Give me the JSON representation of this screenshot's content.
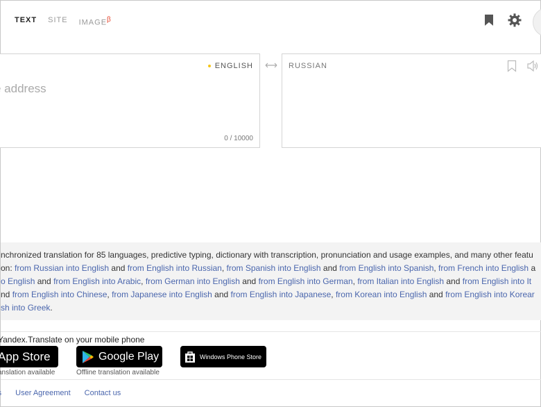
{
  "tabs": [
    {
      "label": "TEXT",
      "sup": ""
    },
    {
      "label": "SITE",
      "sup": ""
    },
    {
      "label": "IMAGE",
      "sup": "β"
    }
  ],
  "header_icons": [
    "bookmark-icon",
    "gear-icon"
  ],
  "source": {
    "language": "ENGLISH",
    "placeholder": "e address",
    "counter": "0 / 10000"
  },
  "target": {
    "language": "RUSSIAN"
  },
  "info": {
    "line1": "nchronized translation for 85 languages, predictive typing, dictionary with transcription, pronunciation and usage examples, and many other featu",
    "line2": [
      {
        "t": "on: "
      },
      {
        "t": "from Russian into English",
        "link": true
      },
      {
        "t": " and "
      },
      {
        "t": "from English into Russian",
        "link": true
      },
      {
        "t": ", "
      },
      {
        "t": "from Spanish into English",
        "link": true
      },
      {
        "t": " and "
      },
      {
        "t": "from English into Spanish",
        "link": true
      },
      {
        "t": ", "
      },
      {
        "t": "from French into English",
        "link": true
      },
      {
        "t": " a"
      }
    ],
    "line3": [
      {
        "t": "o English",
        "link": true
      },
      {
        "t": " and "
      },
      {
        "t": "from English into Arabic",
        "link": true
      },
      {
        "t": ", "
      },
      {
        "t": "from German into English",
        "link": true
      },
      {
        "t": " and "
      },
      {
        "t": "from English into German",
        "link": true
      },
      {
        "t": ", "
      },
      {
        "t": "from Italian into English",
        "link": true
      },
      {
        "t": " and "
      },
      {
        "t": "from English into It",
        "link": true
      }
    ],
    "line4": [
      {
        "t": "nd "
      },
      {
        "t": "from English into Chinese",
        "link": true
      },
      {
        "t": ", "
      },
      {
        "t": "from Japanese into English",
        "link": true
      },
      {
        "t": " and "
      },
      {
        "t": "from English into Japanese",
        "link": true
      },
      {
        "t": ", "
      },
      {
        "t": "from Korean into English",
        "link": true
      },
      {
        "t": " and "
      },
      {
        "t": "from English into Korear",
        "link": true
      }
    ],
    "line5": [
      {
        "t": "sh into Greek",
        "link": true
      },
      {
        "t": "."
      }
    ]
  },
  "mobile": {
    "title": "Yandex.Translate on your mobile phone",
    "appstore_label": "App Store",
    "appstore_caption": "anslation available",
    "gplay_label": "Google Play",
    "gplay_caption": "Offline translation available",
    "wp_label": "Windows Phone Store"
  },
  "footer": {
    "links": [
      "rs",
      "User Agreement",
      "Contact us"
    ]
  },
  "colors": {
    "link": "#4a66ad",
    "accent_dot": "#f5c518",
    "beta": "#e5432b"
  }
}
